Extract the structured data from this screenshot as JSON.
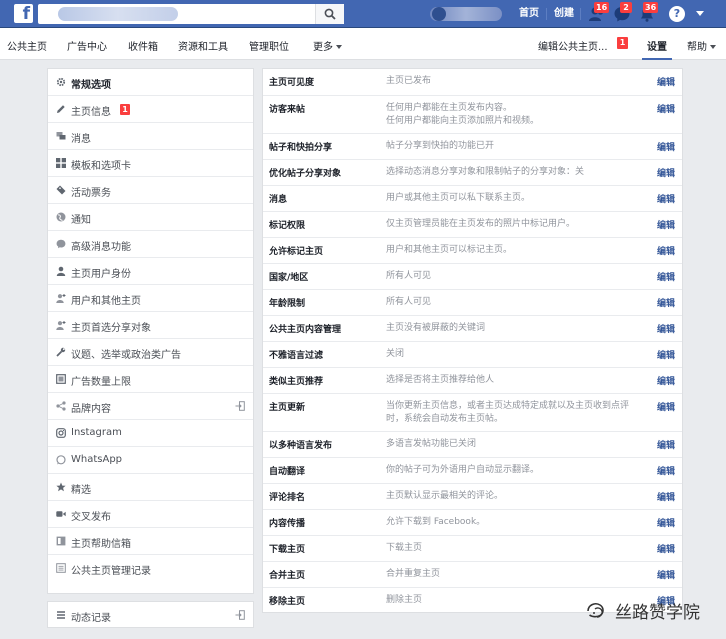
{
  "topbar": {
    "logo": "f",
    "links": {
      "home": "首页",
      "create": "创建"
    },
    "badges": {
      "friends": "16",
      "messages": "2",
      "notifications": "36"
    },
    "help": "?"
  },
  "subnav": {
    "items": [
      "公共主页",
      "广告中心",
      "收件箱",
      "资源和工具",
      "管理职位",
      "更多"
    ],
    "edit_page": "编辑公共主页...",
    "edit_badge": "1",
    "settings": "设置",
    "help": "帮助"
  },
  "sidebar": {
    "items": [
      {
        "label": "常规选项",
        "icon": "gear-icon"
      },
      {
        "label": "主页信息",
        "icon": "pencil-icon",
        "badge": "1"
      },
      {
        "label": "消息",
        "icon": "chat-icon"
      },
      {
        "label": "模板和选项卡",
        "icon": "grid-icon"
      },
      {
        "label": "活动票务",
        "icon": "ticket-icon"
      },
      {
        "label": "通知",
        "icon": "globe-icon"
      },
      {
        "label": "高级消息功能",
        "icon": "messenger-icon"
      },
      {
        "label": "主页用户身份",
        "icon": "user-icon"
      },
      {
        "label": "用户和其他主页",
        "icon": "user-plus-icon"
      },
      {
        "label": "主页首选分享对象",
        "icon": "user-plus-icon"
      },
      {
        "label": "议题、选举或政治类广告",
        "icon": "wrench-icon"
      },
      {
        "label": "广告数量上限",
        "icon": "square-icon"
      },
      {
        "label": "品牌内容",
        "icon": "branded-content-icon"
      },
      {
        "label": "Instagram",
        "icon": "instagram-icon"
      },
      {
        "label": "WhatsApp",
        "icon": "whatsapp-icon"
      },
      {
        "label": "精选",
        "icon": "star-icon"
      },
      {
        "label": "交叉发布",
        "icon": "video-icon"
      },
      {
        "label": "主页帮助信箱",
        "icon": "inbox-icon"
      },
      {
        "label": "公共主页管理记录",
        "icon": "list-icon"
      }
    ],
    "activity": "动态记录"
  },
  "settings": {
    "edit_label": "编辑",
    "rows": [
      {
        "key": "主页可见度",
        "value": "主页已发布"
      },
      {
        "key": "访客来帖",
        "value": "任何用户都能在主页发布内容。",
        "value2": "任何用户都能向主页添加照片和视频。"
      },
      {
        "key": "帖子和快拍分享",
        "value": "帖子分享到快拍的功能已开"
      },
      {
        "key": "优化帖子分享对象",
        "value": "选择动态消息分享对象和限制帖子的分享对象：关"
      },
      {
        "key": "消息",
        "value": "用户或其他主页可以私下联系主页。"
      },
      {
        "key": "标记权限",
        "value": "仅主页管理员能在主页发布的照片中标记用户。"
      },
      {
        "key": "允许标记主页",
        "value": "用户和其他主页可以标记主页。"
      },
      {
        "key": "国家/地区",
        "value": "所有人可见"
      },
      {
        "key": "年龄限制",
        "value": "所有人可见"
      },
      {
        "key": "公共主页内容管理",
        "value": "主页没有被屏蔽的关键词"
      },
      {
        "key": "不雅语言过滤",
        "value": "关闭"
      },
      {
        "key": "类似主页推荐",
        "value": "选择是否将主页推荐给他人"
      },
      {
        "key": "主页更新",
        "value": "当你更新主页信息，或者主页达成特定成就以及主页收到点评时，系统会自动发布主页帖。"
      },
      {
        "key": "以多种语言发布",
        "value": "多语言发帖功能已关闭"
      },
      {
        "key": "自动翻译",
        "value": "你的帖子可为外语用户自动显示翻译。"
      },
      {
        "key": "评论排名",
        "value": "主页默认显示最相关的评论。"
      },
      {
        "key": "内容传播",
        "value": "允许下载到 Facebook。"
      },
      {
        "key": "下载主页",
        "value": "下载主页"
      },
      {
        "key": "合并主页",
        "value": "合并重复主页"
      },
      {
        "key": "移除主页",
        "value": "删除主页"
      }
    ]
  },
  "watermark": {
    "text": "丝路赞学院"
  },
  "colors": {
    "brand": "#4267b2",
    "link": "#365899",
    "badge": "#fa3e3e"
  }
}
